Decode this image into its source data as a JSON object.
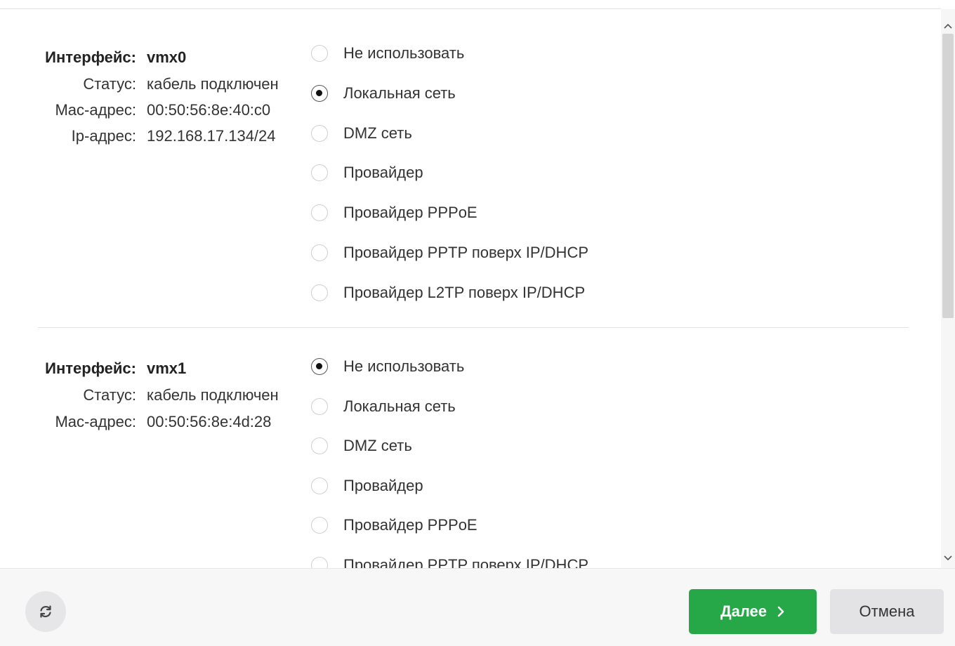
{
  "interfaces": [
    {
      "rows": [
        {
          "label": "Интерфейс:",
          "value": "vmx0"
        },
        {
          "label": "Статус:",
          "value": "кабель подключен"
        },
        {
          "label": "Mac-адрес:",
          "value": "00:50:56:8e:40:c0"
        },
        {
          "label": "Ip-адрес:",
          "value": "192.168.17.134/24"
        }
      ],
      "options": [
        {
          "label": "Не использовать",
          "checked": false
        },
        {
          "label": "Локальная сеть",
          "checked": true
        },
        {
          "label": "DMZ сеть",
          "checked": false
        },
        {
          "label": "Провайдер",
          "checked": false
        },
        {
          "label": "Провайдер PPPoE",
          "checked": false
        },
        {
          "label": "Провайдер PPTP поверх IP/DHCP",
          "checked": false
        },
        {
          "label": "Провайдер L2TP поверх IP/DHCP",
          "checked": false
        }
      ]
    },
    {
      "rows": [
        {
          "label": "Интерфейс:",
          "value": "vmx1"
        },
        {
          "label": "Статус:",
          "value": "кабель подключен"
        },
        {
          "label": "Mac-адрес:",
          "value": "00:50:56:8e:4d:28"
        }
      ],
      "options": [
        {
          "label": "Не использовать",
          "checked": true
        },
        {
          "label": "Локальная сеть",
          "checked": false
        },
        {
          "label": "DMZ сеть",
          "checked": false
        },
        {
          "label": "Провайдер",
          "checked": false
        },
        {
          "label": "Провайдер PPPoE",
          "checked": false
        },
        {
          "label": "Провайдер PPTP поверх IP/DHCP",
          "checked": false
        }
      ]
    }
  ],
  "footer": {
    "refresh_icon": "refresh-icon",
    "next_label": "Далее",
    "next_icon": "chevron-right-icon",
    "cancel_label": "Отмена"
  },
  "colors": {
    "primary_button": "#26a848",
    "secondary_button": "#e3e3e6",
    "footer_background": "#f7f7f8"
  }
}
